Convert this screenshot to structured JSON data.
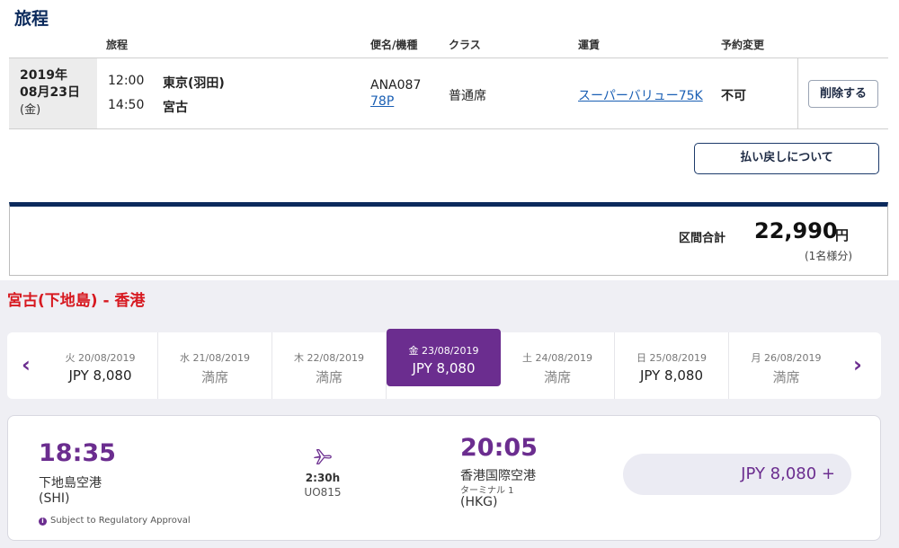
{
  "top": {
    "title": "旅程",
    "headers": {
      "itinerary": "旅程",
      "flight": "便名/機種",
      "class": "クラス",
      "fare": "運賃",
      "change": "予約変更"
    },
    "row": {
      "date_line1": "2019年",
      "date_line2": "08月23日",
      "date_line3": "(金)",
      "dep_time": "12:00",
      "dep_place": "東京(羽田)",
      "arr_time": "14:50",
      "arr_place": "宮古",
      "flight_no": "ANA087",
      "aircraft": "78P",
      "class": "普通席",
      "fare": "スーパーバリュー75K",
      "change": "不可",
      "delete_label": "削除する"
    },
    "refund_label": "払い戻しについて",
    "total": {
      "label": "区間合計",
      "amount": "22,990",
      "currency": "円",
      "note": "(1名様分)"
    }
  },
  "bottom": {
    "route_title": "宮古(下地島) - 香港",
    "prev_icon": "chevron-left-icon",
    "next_icon": "chevron-right-icon",
    "days": [
      {
        "label": "火 20/08/2019",
        "price": "JPY 8,080",
        "full": false,
        "selected": false
      },
      {
        "label": "水 21/08/2019",
        "price": "満席",
        "full": true,
        "selected": false
      },
      {
        "label": "木 22/08/2019",
        "price": "満席",
        "full": true,
        "selected": false
      },
      {
        "label": "金 23/08/2019",
        "price": "JPY 8,080",
        "full": false,
        "selected": true
      },
      {
        "label": "土 24/08/2019",
        "price": "満席",
        "full": true,
        "selected": false
      },
      {
        "label": "日 25/08/2019",
        "price": "JPY 8,080",
        "full": false,
        "selected": false
      },
      {
        "label": "月 26/08/2019",
        "price": "満席",
        "full": true,
        "selected": false
      }
    ],
    "flight": {
      "dep_time": "18:35",
      "dep_airport": "下地島空港",
      "dep_code": "(SHI)",
      "duration": "2:30h",
      "flight_no": "UO815",
      "arr_time": "20:05",
      "arr_airport": "香港国際空港",
      "arr_terminal": "ターミナル 1",
      "arr_code": "(HKG)",
      "price": "JPY  8,080 +",
      "notice": "Subject to Regulatory Approval",
      "notice_icon": "info-icon",
      "plane_icon": "plane-icon"
    },
    "colors": {
      "accent": "#6b2d8f",
      "route_title": "#d71920",
      "ana_navy": "#0b2a5c"
    }
  }
}
